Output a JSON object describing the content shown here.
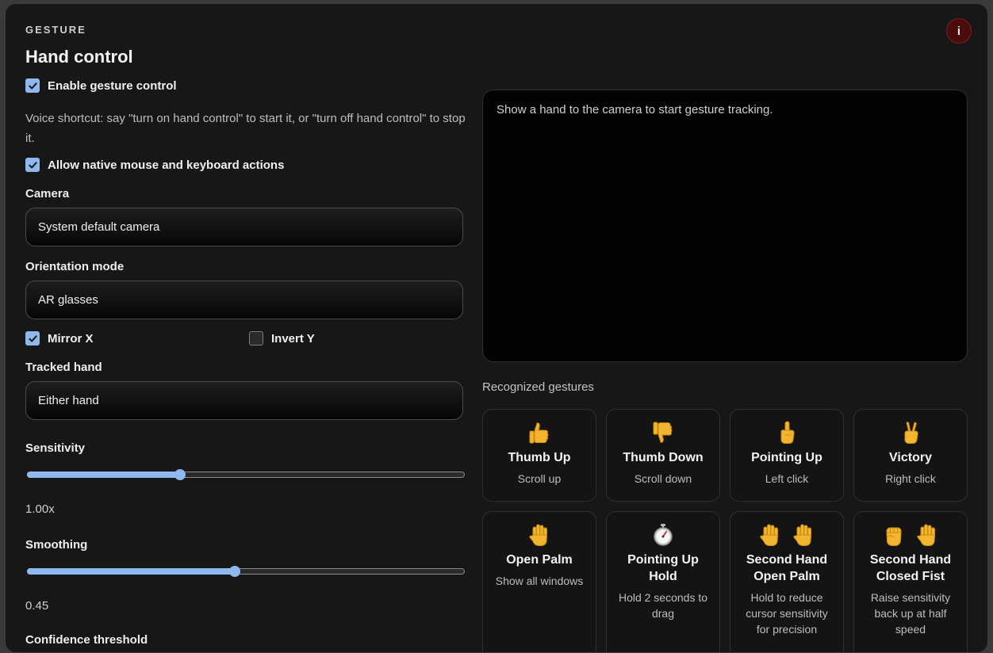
{
  "header": {
    "eyebrow": "GESTURE",
    "title": "Hand control",
    "info_label": "i"
  },
  "controls": {
    "enable_gesture": {
      "label": "Enable gesture control",
      "checked": true
    },
    "voice_help": "Voice shortcut: say \"turn on hand control\" to start it, or \"turn off hand control\" to stop it.",
    "native_actions": {
      "label": "Allow native mouse and keyboard actions",
      "checked": true
    },
    "camera": {
      "label": "Camera",
      "value": "System default camera"
    },
    "orientation": {
      "label": "Orientation mode",
      "value": "AR glasses"
    },
    "mirror_x": {
      "label": "Mirror X",
      "checked": true
    },
    "invert_y": {
      "label": "Invert Y",
      "checked": false
    },
    "tracked_hand": {
      "label": "Tracked hand",
      "value": "Either hand"
    },
    "sensitivity": {
      "label": "Sensitivity",
      "value_text": "1.00x",
      "fraction": 0.35
    },
    "smoothing": {
      "label": "Smoothing",
      "value_text": "0.45",
      "fraction": 0.475
    },
    "confidence": {
      "label": "Confidence threshold"
    }
  },
  "preview": {
    "message": "Show a hand to the camera to start gesture tracking."
  },
  "gestures": {
    "label": "Recognized gestures",
    "items": [
      {
        "icon": "thumbs-up-icon",
        "name": "Thumb Up",
        "action": "Scroll up"
      },
      {
        "icon": "thumbs-down-icon",
        "name": "Thumb Down",
        "action": "Scroll down"
      },
      {
        "icon": "pointing-up-icon",
        "name": "Pointing Up",
        "action": "Left click"
      },
      {
        "icon": "victory-hand-icon",
        "name": "Victory",
        "action": "Right click"
      },
      {
        "icon": "open-palm-icon",
        "name": "Open Palm",
        "action": "Show all windows"
      },
      {
        "icon": "stopwatch-icon",
        "name": "Pointing Up Hold",
        "action": "Hold 2 seconds to drag"
      },
      {
        "icon": "two-open-palms-icon",
        "name": "Second Hand Open Palm",
        "action": "Hold to reduce cursor sensitivity for precision"
      },
      {
        "icon": "fist-and-palm-icon",
        "name": "Second Hand Closed Fist",
        "action": "Raise sensitivity back up at half speed"
      }
    ]
  },
  "colors": {
    "accent": "#8fb8ef",
    "emoji_skin": "#f2b52e",
    "info_button": "#4a0b0b"
  }
}
